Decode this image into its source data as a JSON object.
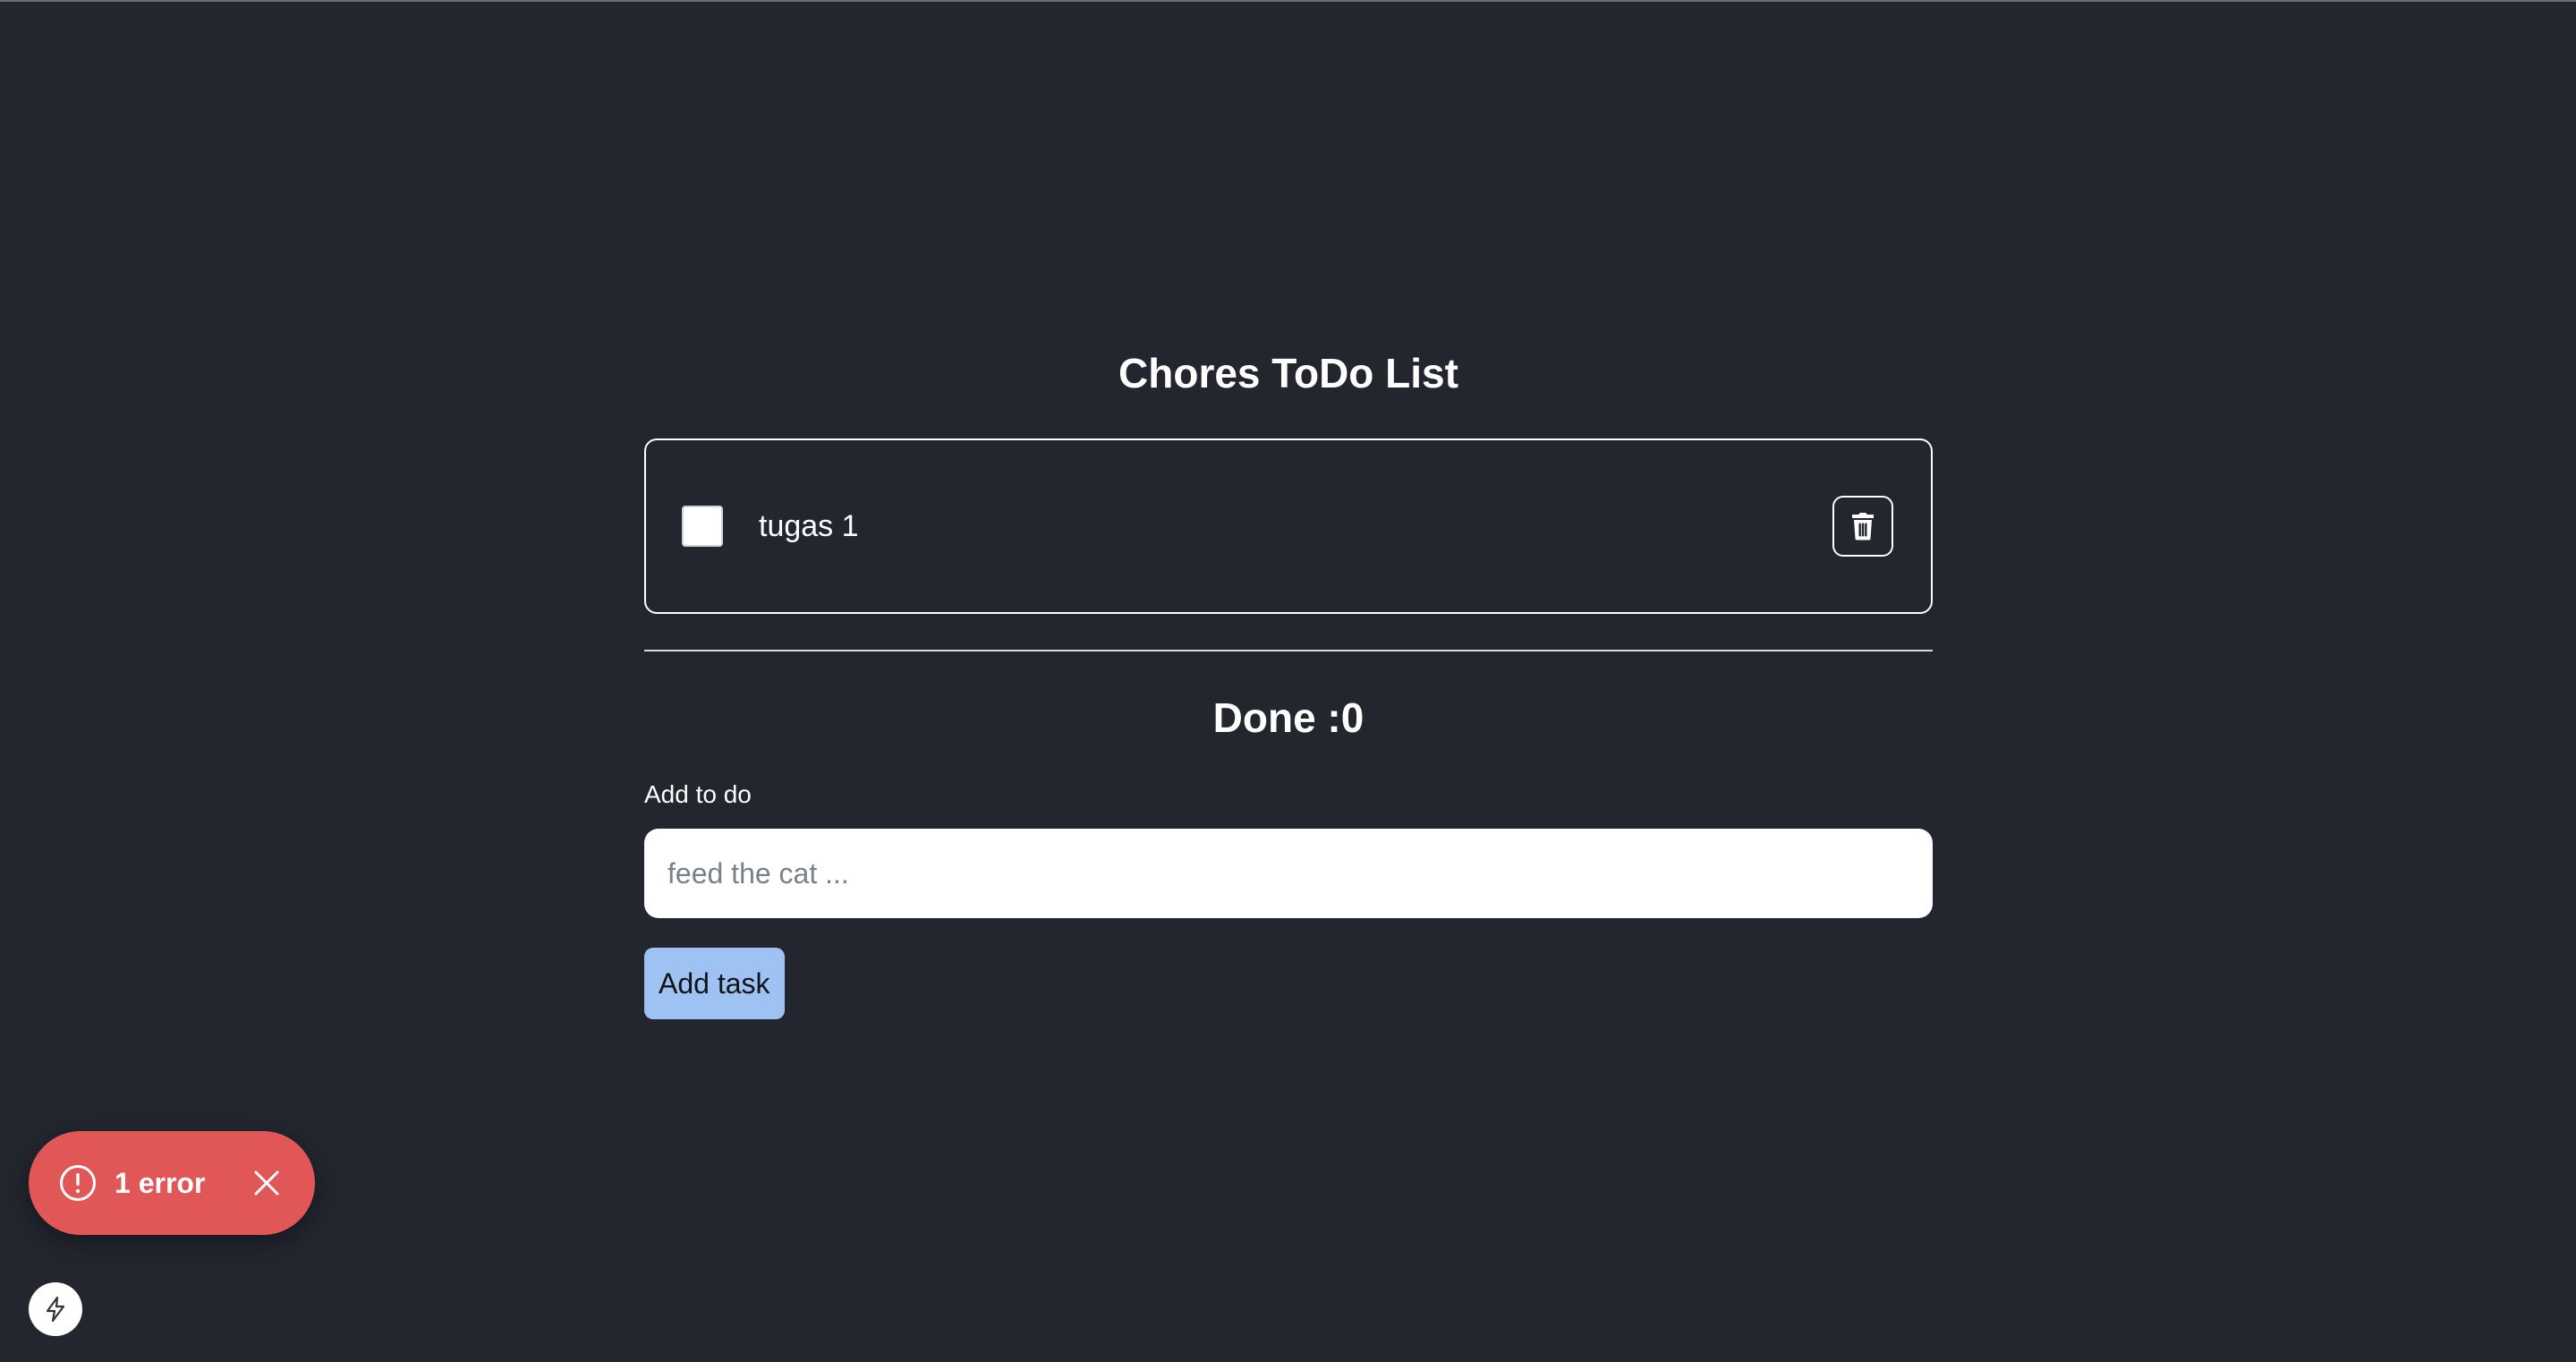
{
  "app": {
    "title": "Chores ToDo List"
  },
  "tasks": [
    {
      "label": "tugas 1",
      "checked": false
    }
  ],
  "icons": {
    "delete": "trash-icon",
    "error": "exclamation-circle-icon",
    "close": "close-icon",
    "dev_tools": "lightning-bolt-icon"
  },
  "summary": {
    "done_text": "Done :0"
  },
  "form": {
    "label": "Add to do",
    "input_value": "",
    "placeholder": "feed the cat ...",
    "submit_label": "Add task"
  },
  "error_toast": {
    "text": "1 error"
  },
  "colors": {
    "background": "#23252f",
    "button_accent": "#9ec2f2",
    "error": "#e15656"
  }
}
